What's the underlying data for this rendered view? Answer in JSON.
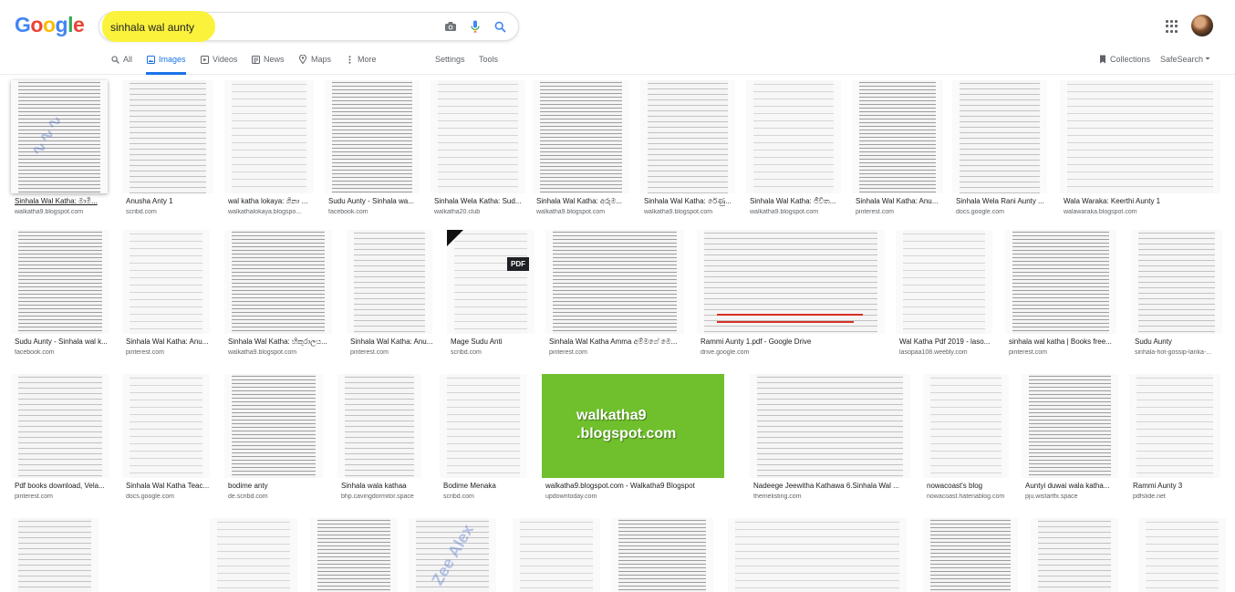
{
  "logo": [
    "G",
    "o",
    "o",
    "g",
    "l",
    "e"
  ],
  "search": {
    "query": "sinhala wal aunty",
    "highlight_color": "#fbf23b"
  },
  "tabs": [
    {
      "label": "All",
      "icon": "search-icon"
    },
    {
      "label": "Images",
      "icon": "image-icon",
      "active": true
    },
    {
      "label": "Videos",
      "icon": "video-icon"
    },
    {
      "label": "News",
      "icon": "news-icon"
    },
    {
      "label": "Maps",
      "icon": "map-pin-icon"
    },
    {
      "label": "More",
      "icon": "more-vert-icon"
    }
  ],
  "tools": {
    "settings": "Settings",
    "tools": "Tools",
    "collections": "Collections",
    "safesearch": "SafeSearch"
  },
  "accent": "#1a73e8",
  "rows": [
    [
      {
        "caption": "Sinhala Wal Katha: මාමි...",
        "source": "walkatha9.blogspot.com",
        "selected": true
      },
      {
        "caption": "Anusha Anty 1",
        "source": "scribd.com"
      },
      {
        "caption": "wal katha lokaya: ගිනා ...",
        "source": "walkathalokaya.blogspo..."
      },
      {
        "caption": "Sudu Aunty - Sinhala wa...",
        "source": "facebook.com"
      },
      {
        "caption": "Sinhala Wela Katha: Sud...",
        "source": "walkatha20.club"
      },
      {
        "caption": "Sinhala Wal Katha: අරුම...",
        "source": "walkatha9.blogspot.com"
      },
      {
        "caption": "Sinhala Wal Katha: රේණු...",
        "source": "walkatha9.blogspot.com"
      },
      {
        "caption": "Sinhala Wal Katha: ජීවිත...",
        "source": "walkatha9.blogspot.com"
      },
      {
        "caption": "Sinhala Wal Katha: Anu...",
        "source": "pinterest.com"
      },
      {
        "caption": "Sinhala Wela Rani Aunty ...",
        "source": "docs.google.com"
      },
      {
        "caption": "Wala Waraka: Keerthi Aunty 1",
        "source": "walawaraka.blogspot.com"
      }
    ],
    [
      {
        "caption": "Sudu Aunty - Sinhala wal k...",
        "source": "facebook.com"
      },
      {
        "caption": "Sinhala Wal Katha: Anu...",
        "source": "pinterest.com"
      },
      {
        "caption": "Sinhala Wal Katha: හිකුරාලය...",
        "source": "walkatha9.blogspot.com"
      },
      {
        "caption": "Sinhala Wal Katha: Anu...",
        "source": "pinterest.com"
      },
      {
        "caption": "Mage Sudu Anti",
        "source": "scribd.com"
      },
      {
        "caption": "Sinhala Wal Katha Amma අම්මගේ මෙ...",
        "source": "pinterest.com"
      },
      {
        "caption": "Rammi Aunty 1.pdf - Google Drive",
        "source": "drive.google.com"
      },
      {
        "caption": "Wal Katha Pdf 2019 - laso...",
        "source": "lasopaa108.weebly.com"
      },
      {
        "caption": "sinhala wal katha | Books free...",
        "source": "pinterest.com"
      },
      {
        "caption": "Sudu Aunty",
        "source": "sinhala-hot-gossip-lanka-..."
      }
    ],
    [
      {
        "caption": "Pdf books download, Vela...",
        "source": "pinterest.com"
      },
      {
        "caption": "Sinhala Wal Katha Teac...",
        "source": "docs.google.com"
      },
      {
        "caption": "bodime anty",
        "source": "de.scribd.com"
      },
      {
        "caption": "Sinhala wala kathaa",
        "source": "bhp.cavingdormitor.space"
      },
      {
        "caption": "Bodime Menaka",
        "source": "scribd.com"
      },
      {
        "caption": "walkatha9.blogspot.com - Walkatha9 Blogspot",
        "source": "updowntoday.com"
      },
      {
        "caption": "Nadeege Jeewitha Kathawa 6.Sinhala Wal ...",
        "source": "themelisting.com"
      },
      {
        "caption": "nowacoast's blog",
        "source": "nowacoast.hatenablog.com"
      },
      {
        "caption": "Auntyi duwai wala katha...",
        "source": "pju.wistartfx.space"
      },
      {
        "caption": "Rammi Aunty 3",
        "source": "pdfslide.net"
      }
    ]
  ],
  "thumb_text": {
    "green_banner": "walkatha9\n.blogspot.com",
    "pdf_badge": "PDF",
    "watermark": "Zee Alex"
  }
}
